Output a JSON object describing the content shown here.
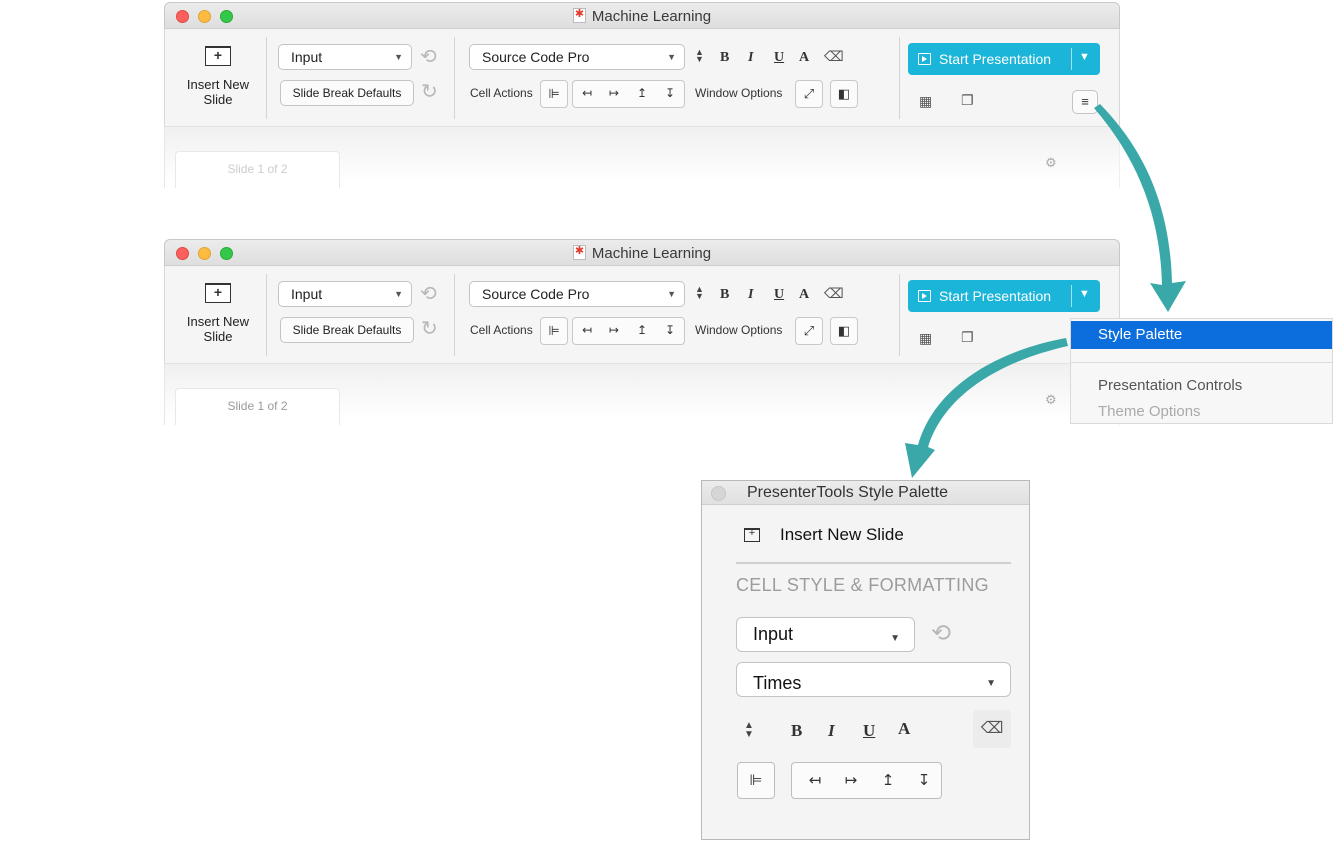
{
  "window": {
    "title": "Machine Learning",
    "insert_new_slide": "Insert New Slide",
    "style_dropdown": "Input",
    "slide_break_defaults": "Slide Break Defaults",
    "font_dropdown": "Source Code Pro",
    "cell_actions_label": "Cell Actions",
    "window_options_label": "Window Options",
    "start_presentation": "Start Presentation",
    "slide_counter": "Slide 1 of 2",
    "format": {
      "bold": "B",
      "italic": "I",
      "underline": "U",
      "text_color": "A"
    }
  },
  "menu": {
    "items": [
      "Style Palette",
      "Presentation Controls",
      "Theme Options"
    ],
    "selected": "Style Palette",
    "selected_color": "#0c6edc"
  },
  "palette": {
    "title": "PresenterTools Style Palette",
    "insert_new_slide": "Insert New Slide",
    "section_heading": "CELL STYLE & FORMATTING",
    "style_dropdown": "Input",
    "font_dropdown": "Times",
    "format": {
      "bold": "B",
      "italic": "I",
      "underline": "U",
      "text_color": "A"
    }
  },
  "colors": {
    "accent": "#1ab5d9",
    "arrow": "#3aa8a8"
  }
}
